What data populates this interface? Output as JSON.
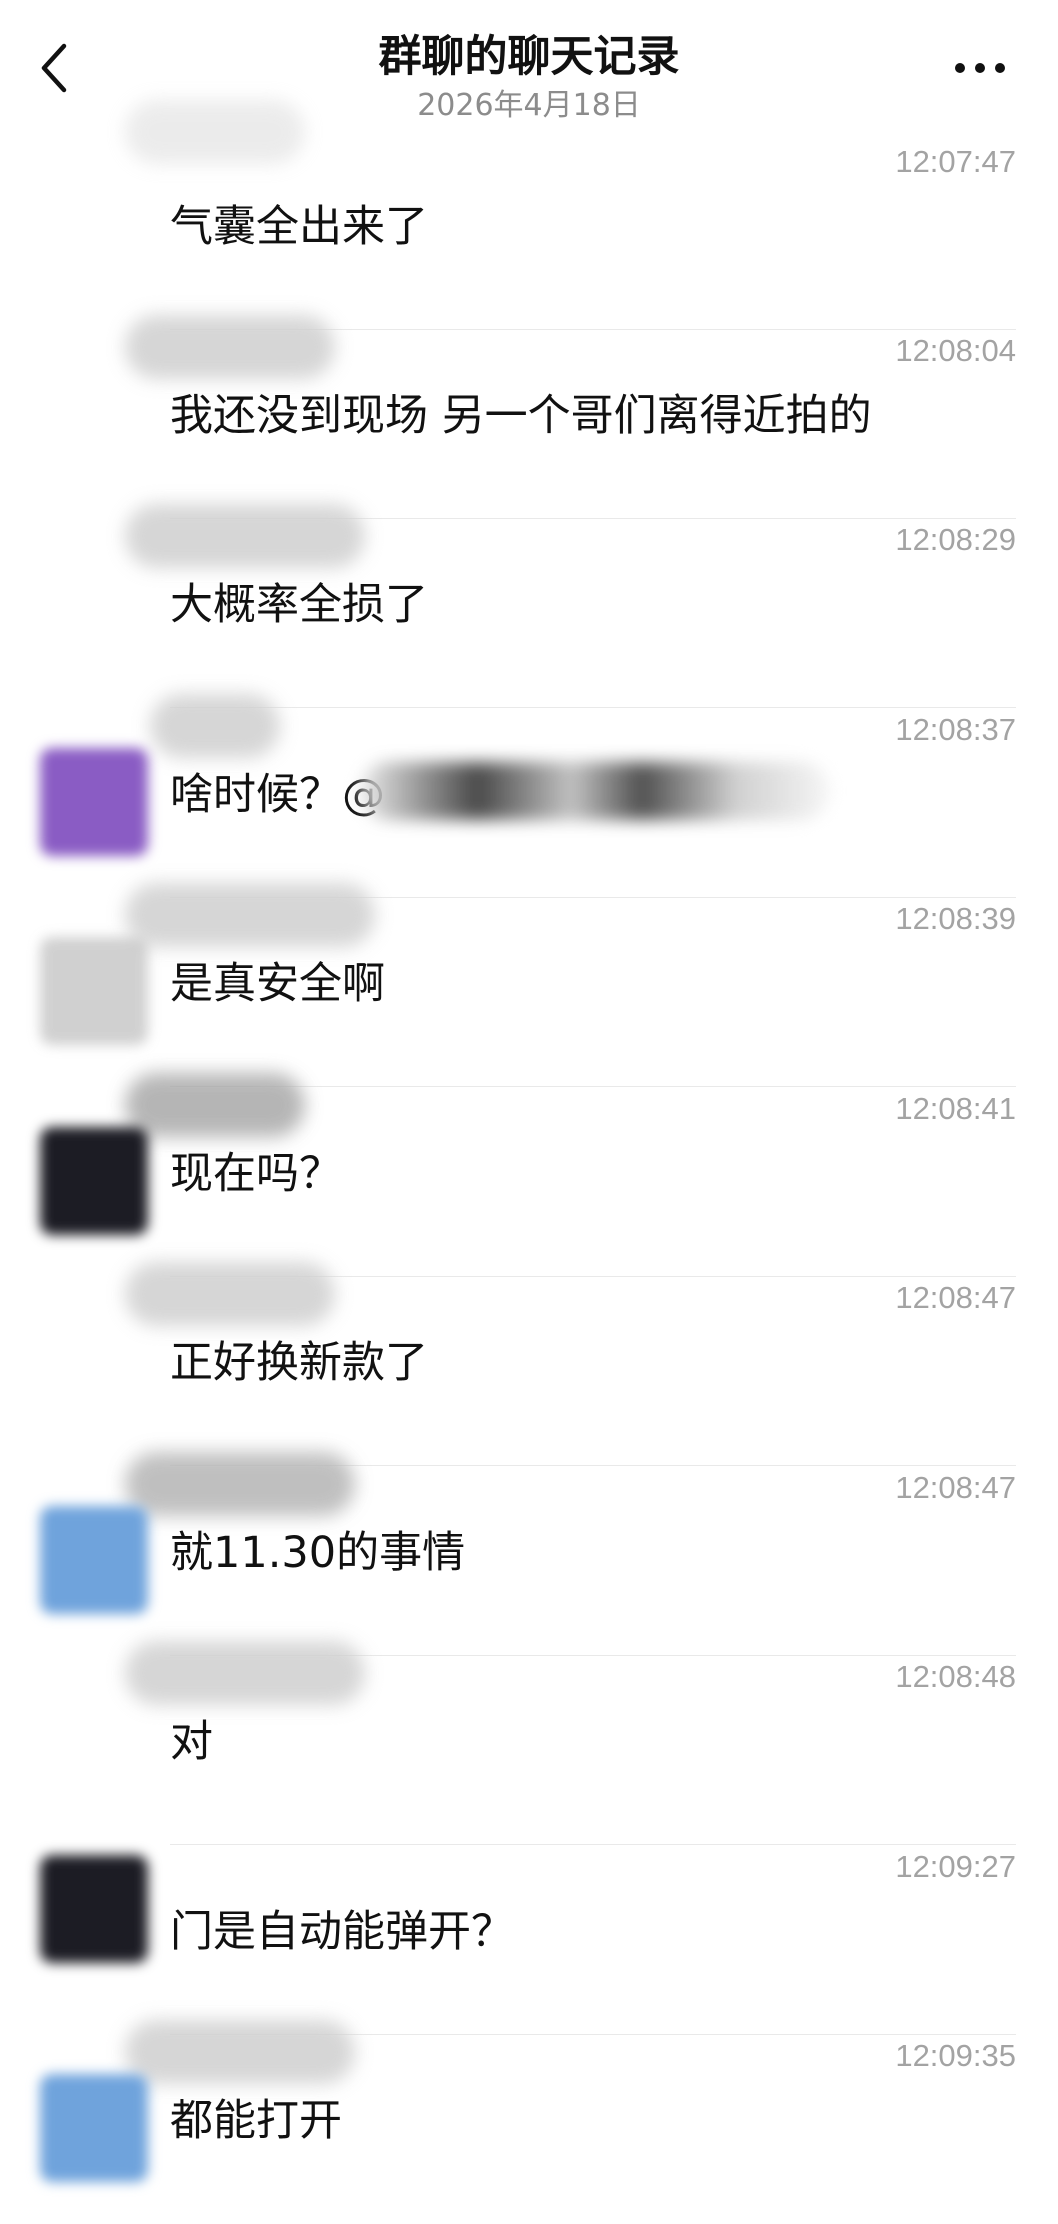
{
  "header": {
    "title": "群聊的聊天记录",
    "date": "2026年4月18日",
    "back_icon": "chevron-left-icon",
    "more_icon": "more-horizontal-icon"
  },
  "messages": [
    {
      "time": "12:07:47",
      "text": "气囊全出来了"
    },
    {
      "time": "12:08:04",
      "text": "我还没到现场 另一个哥们离得近拍的"
    },
    {
      "time": "12:08:29",
      "text": "大概率全损了"
    },
    {
      "time": "12:08:37",
      "text": "啥时候？@"
    },
    {
      "time": "12:08:39",
      "text": "是真安全啊"
    },
    {
      "time": "12:08:41",
      "text": "现在吗？"
    },
    {
      "time": "12:08:47",
      "text": "正好换新款了"
    },
    {
      "time": "12:08:47",
      "text": "就11.30的事情"
    },
    {
      "time": "12:08:48",
      "text": "对"
    },
    {
      "time": "12:09:27",
      "text": "门是自动能弹开？"
    },
    {
      "time": "12:09:35",
      "text": "都能打开"
    }
  ],
  "avatar_colors": {
    "purple": "#8a5cc4",
    "dark": "#1c1c24",
    "blue": "#6fa3dc",
    "grey": "#bdbdbd",
    "pink": "#e7a3a3"
  }
}
